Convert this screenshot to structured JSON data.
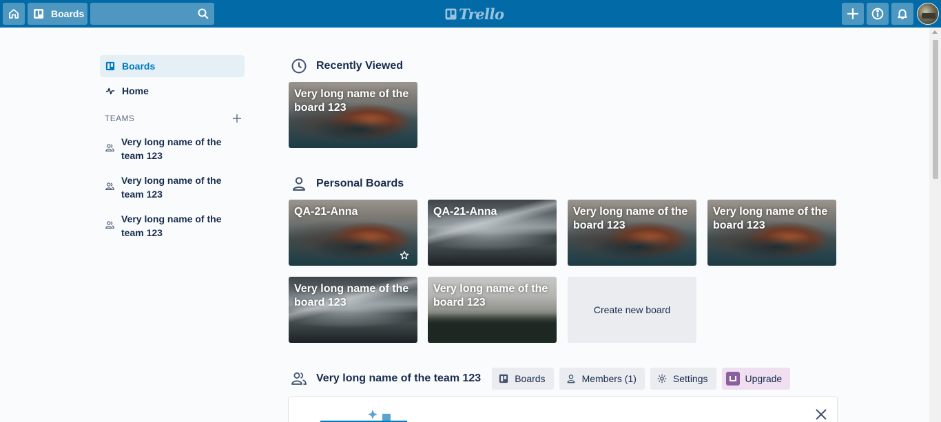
{
  "header": {
    "boards_label": "Boards",
    "search": {
      "value": "",
      "placeholder": ""
    },
    "logo_text": "Trello"
  },
  "sidebar": {
    "items": [
      {
        "label": "Boards",
        "icon": "board-icon",
        "active": true
      },
      {
        "label": "Home",
        "icon": "activity-icon",
        "active": false
      }
    ],
    "teams_heading": "TEAMS",
    "teams": [
      {
        "name": "Very long name of the team 123"
      },
      {
        "name": "Very long name of the team 123"
      },
      {
        "name": "Very long name of the team 123"
      }
    ]
  },
  "recently_viewed": {
    "heading": "Recently Viewed",
    "boards": [
      {
        "title": "Very long name of the board 123"
      }
    ]
  },
  "personal_boards": {
    "heading": "Personal Boards",
    "boards": [
      {
        "title": "QA-21-Anna",
        "starred": true
      },
      {
        "title": "QA-21-Anna"
      },
      {
        "title": "Very long name of the board 123"
      },
      {
        "title": "Very long name of the board 123"
      },
      {
        "title": "Very long name of the board 123"
      },
      {
        "title": "Very long name of the board 123"
      }
    ],
    "create_label": "Create new board"
  },
  "team_section": {
    "title": "Very long name of the team 123",
    "buttons": {
      "boards": "Boards",
      "members": "Members (1)",
      "settings": "Settings",
      "upgrade": "Upgrade"
    }
  },
  "colors": {
    "header_bg": "#026aa7",
    "accent": "#0079bf",
    "upgrade": "#89609e",
    "text": "#172b4d"
  }
}
